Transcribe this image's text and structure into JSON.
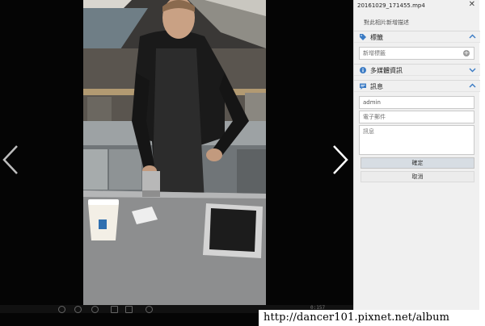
{
  "panel": {
    "filename": "20161029_171455.mp4",
    "description_placeholder": "對此相片新增描述",
    "sections": {
      "tags": "標籤",
      "media_info": "多媒體資訊",
      "message": "訊息"
    },
    "tag_placeholder": "新增標籤",
    "name_value": "admin",
    "email_placeholder": "電子郵件",
    "message_placeholder": "訊息",
    "confirm_label": "確定",
    "cancel_label": "取消",
    "close_symbol": "✕",
    "add_symbol": "+"
  },
  "player": {
    "time": "0:157"
  },
  "watermark": "http://dancer101.pixnet.net/album",
  "icons": [
    "arrow-left-icon",
    "arrow-right-icon",
    "close-icon",
    "tag-icon",
    "info-icon",
    "message-icon",
    "chevron-up-icon",
    "chevron-down-icon",
    "add-icon"
  ],
  "colors": {
    "accent": "#3b7bc4",
    "panel_bg": "#f0f0f0",
    "viewer_bg": "#050505"
  }
}
